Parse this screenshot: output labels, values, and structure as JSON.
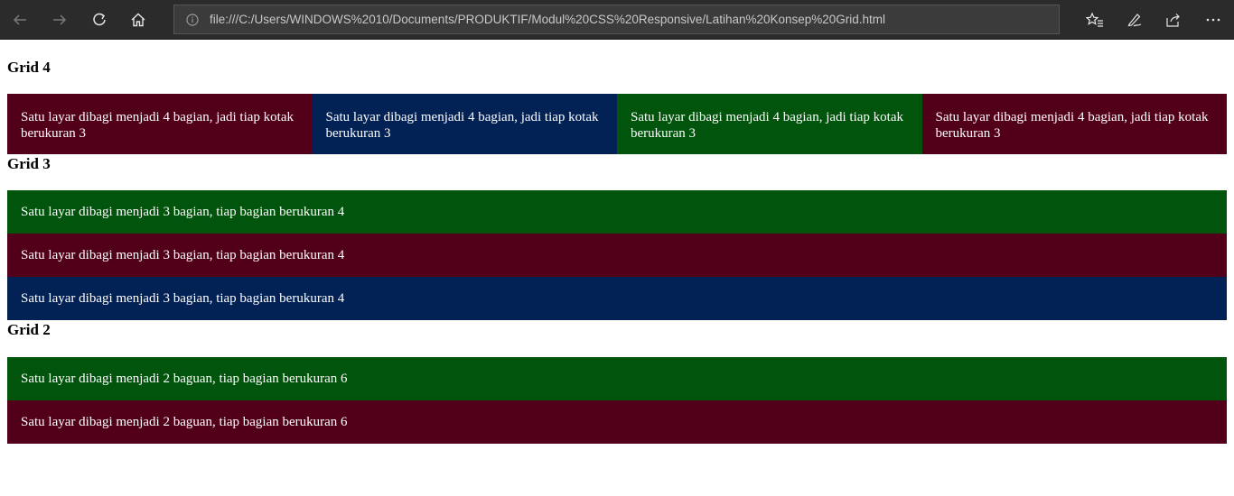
{
  "browser": {
    "url": "file:///C:/Users/WINDOWS%2010/Documents/PRODUKTIF/Modul%20CSS%20Responsive/Latihan%20Konsep%20Grid.html"
  },
  "colors": {
    "maroon": "#520019",
    "navy": "#022155",
    "green": "#01540b",
    "toolbar": "#2b2b2b"
  },
  "grid4": {
    "title": "Grid 4",
    "cells": [
      {
        "text": "Satu layar dibagi menjadi 4 bagian, jadi tiap kotak berukuran 3",
        "color": "#520019"
      },
      {
        "text": "Satu layar dibagi menjadi 4 bagian, jadi tiap kotak berukuran 3",
        "color": "#022155"
      },
      {
        "text": "Satu layar dibagi menjadi 4 bagian, jadi tiap kotak berukuran 3",
        "color": "#01540b"
      },
      {
        "text": "Satu layar dibagi menjadi 4 bagian, jadi tiap kotak berukuran 3",
        "color": "#520019"
      }
    ]
  },
  "grid3": {
    "title": "Grid 3",
    "rows": [
      {
        "text": "Satu layar dibagi menjadi 3 bagian, tiap bagian berukuran 4",
        "color": "#01540b"
      },
      {
        "text": "Satu layar dibagi menjadi 3 bagian, tiap bagian berukuran 4",
        "color": "#520019"
      },
      {
        "text": "Satu layar dibagi menjadi 3 bagian, tiap bagian berukuran 4",
        "color": "#022155"
      }
    ]
  },
  "grid2": {
    "title": "Grid 2",
    "rows": [
      {
        "text": "Satu layar dibagi menjadi 2 baguan, tiap bagian berukuran 6",
        "color": "#01540b"
      },
      {
        "text": "Satu layar dibagi menjadi 2 baguan, tiap bagian berukuran 6",
        "color": "#520019"
      }
    ]
  }
}
